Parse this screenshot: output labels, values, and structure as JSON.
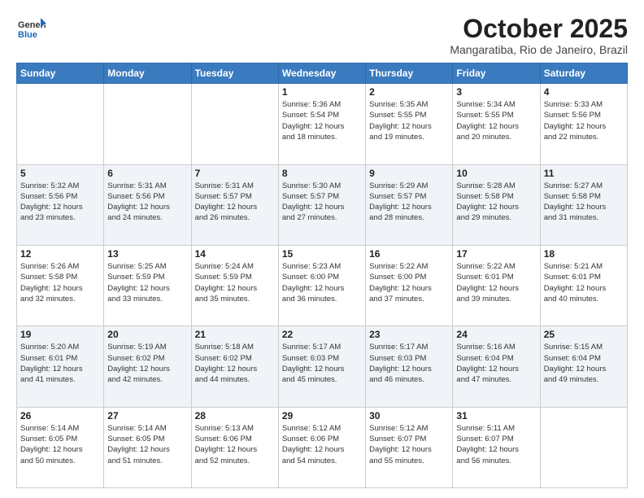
{
  "header": {
    "logo_general": "General",
    "logo_blue": "Blue",
    "month_title": "October 2025",
    "location": "Mangaratiba, Rio de Janeiro, Brazil"
  },
  "days_of_week": [
    "Sunday",
    "Monday",
    "Tuesday",
    "Wednesday",
    "Thursday",
    "Friday",
    "Saturday"
  ],
  "weeks": [
    [
      {
        "num": "",
        "info": ""
      },
      {
        "num": "",
        "info": ""
      },
      {
        "num": "",
        "info": ""
      },
      {
        "num": "1",
        "info": "Sunrise: 5:36 AM\nSunset: 5:54 PM\nDaylight: 12 hours\nand 18 minutes."
      },
      {
        "num": "2",
        "info": "Sunrise: 5:35 AM\nSunset: 5:55 PM\nDaylight: 12 hours\nand 19 minutes."
      },
      {
        "num": "3",
        "info": "Sunrise: 5:34 AM\nSunset: 5:55 PM\nDaylight: 12 hours\nand 20 minutes."
      },
      {
        "num": "4",
        "info": "Sunrise: 5:33 AM\nSunset: 5:56 PM\nDaylight: 12 hours\nand 22 minutes."
      }
    ],
    [
      {
        "num": "5",
        "info": "Sunrise: 5:32 AM\nSunset: 5:56 PM\nDaylight: 12 hours\nand 23 minutes."
      },
      {
        "num": "6",
        "info": "Sunrise: 5:31 AM\nSunset: 5:56 PM\nDaylight: 12 hours\nand 24 minutes."
      },
      {
        "num": "7",
        "info": "Sunrise: 5:31 AM\nSunset: 5:57 PM\nDaylight: 12 hours\nand 26 minutes."
      },
      {
        "num": "8",
        "info": "Sunrise: 5:30 AM\nSunset: 5:57 PM\nDaylight: 12 hours\nand 27 minutes."
      },
      {
        "num": "9",
        "info": "Sunrise: 5:29 AM\nSunset: 5:57 PM\nDaylight: 12 hours\nand 28 minutes."
      },
      {
        "num": "10",
        "info": "Sunrise: 5:28 AM\nSunset: 5:58 PM\nDaylight: 12 hours\nand 29 minutes."
      },
      {
        "num": "11",
        "info": "Sunrise: 5:27 AM\nSunset: 5:58 PM\nDaylight: 12 hours\nand 31 minutes."
      }
    ],
    [
      {
        "num": "12",
        "info": "Sunrise: 5:26 AM\nSunset: 5:58 PM\nDaylight: 12 hours\nand 32 minutes."
      },
      {
        "num": "13",
        "info": "Sunrise: 5:25 AM\nSunset: 5:59 PM\nDaylight: 12 hours\nand 33 minutes."
      },
      {
        "num": "14",
        "info": "Sunrise: 5:24 AM\nSunset: 5:59 PM\nDaylight: 12 hours\nand 35 minutes."
      },
      {
        "num": "15",
        "info": "Sunrise: 5:23 AM\nSunset: 6:00 PM\nDaylight: 12 hours\nand 36 minutes."
      },
      {
        "num": "16",
        "info": "Sunrise: 5:22 AM\nSunset: 6:00 PM\nDaylight: 12 hours\nand 37 minutes."
      },
      {
        "num": "17",
        "info": "Sunrise: 5:22 AM\nSunset: 6:01 PM\nDaylight: 12 hours\nand 39 minutes."
      },
      {
        "num": "18",
        "info": "Sunrise: 5:21 AM\nSunset: 6:01 PM\nDaylight: 12 hours\nand 40 minutes."
      }
    ],
    [
      {
        "num": "19",
        "info": "Sunrise: 5:20 AM\nSunset: 6:01 PM\nDaylight: 12 hours\nand 41 minutes."
      },
      {
        "num": "20",
        "info": "Sunrise: 5:19 AM\nSunset: 6:02 PM\nDaylight: 12 hours\nand 42 minutes."
      },
      {
        "num": "21",
        "info": "Sunrise: 5:18 AM\nSunset: 6:02 PM\nDaylight: 12 hours\nand 44 minutes."
      },
      {
        "num": "22",
        "info": "Sunrise: 5:17 AM\nSunset: 6:03 PM\nDaylight: 12 hours\nand 45 minutes."
      },
      {
        "num": "23",
        "info": "Sunrise: 5:17 AM\nSunset: 6:03 PM\nDaylight: 12 hours\nand 46 minutes."
      },
      {
        "num": "24",
        "info": "Sunrise: 5:16 AM\nSunset: 6:04 PM\nDaylight: 12 hours\nand 47 minutes."
      },
      {
        "num": "25",
        "info": "Sunrise: 5:15 AM\nSunset: 6:04 PM\nDaylight: 12 hours\nand 49 minutes."
      }
    ],
    [
      {
        "num": "26",
        "info": "Sunrise: 5:14 AM\nSunset: 6:05 PM\nDaylight: 12 hours\nand 50 minutes."
      },
      {
        "num": "27",
        "info": "Sunrise: 5:14 AM\nSunset: 6:05 PM\nDaylight: 12 hours\nand 51 minutes."
      },
      {
        "num": "28",
        "info": "Sunrise: 5:13 AM\nSunset: 6:06 PM\nDaylight: 12 hours\nand 52 minutes."
      },
      {
        "num": "29",
        "info": "Sunrise: 5:12 AM\nSunset: 6:06 PM\nDaylight: 12 hours\nand 54 minutes."
      },
      {
        "num": "30",
        "info": "Sunrise: 5:12 AM\nSunset: 6:07 PM\nDaylight: 12 hours\nand 55 minutes."
      },
      {
        "num": "31",
        "info": "Sunrise: 5:11 AM\nSunset: 6:07 PM\nDaylight: 12 hours\nand 56 minutes."
      },
      {
        "num": "",
        "info": ""
      }
    ]
  ]
}
